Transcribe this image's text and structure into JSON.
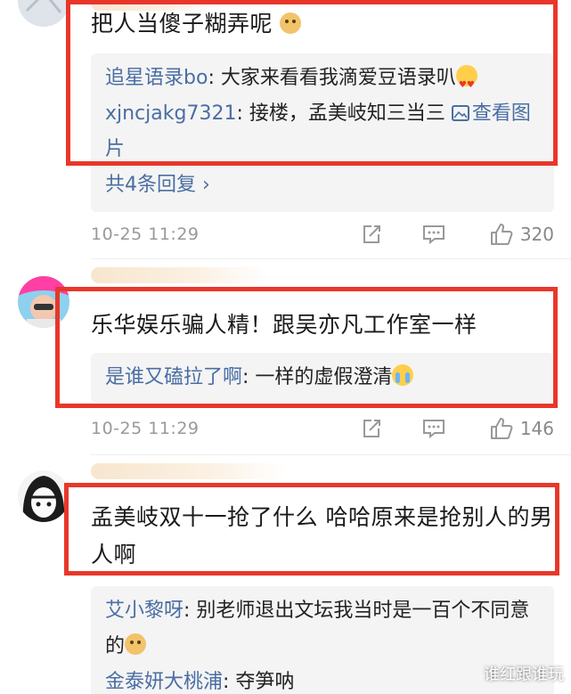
{
  "comments": [
    {
      "text": "把人当傻子糊弄呢",
      "emoji": "doge-emoji",
      "replies": [
        {
          "name": "追星语录bo",
          "text": ": 大家来看看我滴爱豆语录叭",
          "emoji": "heart-eyes-emoji"
        },
        {
          "name": "xjncjakg7321",
          "text": ": 接楼，孟美岐知三当三 ",
          "pic_label": "查看图片"
        }
      ],
      "more_replies": "共4条回复 ›",
      "time": "10-25 11:29",
      "likes": "320"
    },
    {
      "text": "乐华娱乐骗人精！跟吴亦凡工作室一样",
      "replies": [
        {
          "name": "是谁又磕拉了啊",
          "text": ": 一样的虚假澄清",
          "emoji": "crying-emoji"
        }
      ],
      "time": "10-25 11:29",
      "likes": "146"
    },
    {
      "text": "孟美岐双十一抢了什么 哈哈原来是抢别人的男人啊",
      "replies": [
        {
          "name": "艾小黎呀",
          "text": ": 别老师退出文坛我当时是一百个不同意的",
          "emoji": "doge-emoji"
        },
        {
          "name": "金泰妍大桃浦",
          "text": ": 夺笋呐"
        }
      ]
    }
  ],
  "watermark": "谁红跟谁玩",
  "colors": {
    "highlight_box": "#e8372a",
    "reply_name": "#4a6ea3",
    "reply_bg": "#f4f4f4"
  }
}
